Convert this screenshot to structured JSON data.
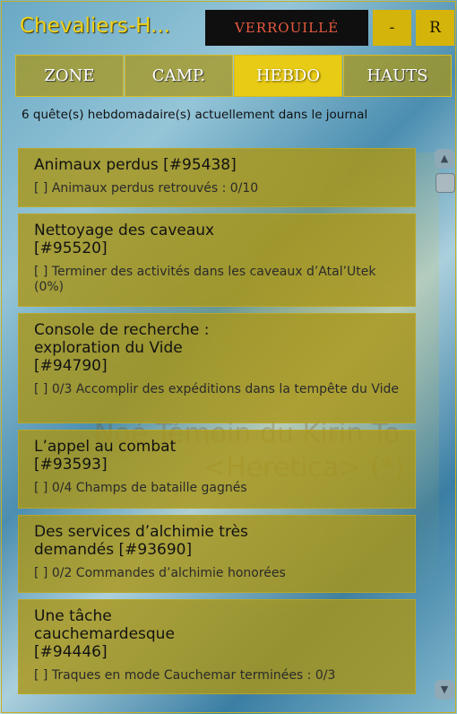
{
  "header": {
    "title": "Chevaliers-H...",
    "lock_label": "VERROUILLÉ",
    "minimize_label": "-",
    "reset_label": "R"
  },
  "tabs": [
    {
      "label": "ZONE"
    },
    {
      "label": "CAMP."
    },
    {
      "label": "HEBDO"
    },
    {
      "label": "HAUTS"
    }
  ],
  "summary": "6 quête(s) hebdomadaire(s) actuellement dans le journal",
  "quests": [
    {
      "title": "Animaux perdus",
      "id": "[#95438]",
      "objective": "[ ] Animaux perdus retrouvés : 0/10"
    },
    {
      "title": "Nettoyage des caveaux",
      "id": "[#95520]",
      "objective": "[ ] Terminer des activités dans les caveaux d’Atal’Utek (0%)"
    },
    {
      "title": "Console de recherche : exploration du Vide",
      "id": "[#94790]",
      "objective": "[ ] 0/3 Accomplir des expéditions dans la tempête du Vide"
    },
    {
      "title": "L’appel au combat",
      "id": "[#93593]",
      "objective": "[ ] 0/4 Champs de bataille gagnés"
    },
    {
      "title": "Des services d’alchimie très demandés",
      "id": "[#93690]",
      "objective": "[ ] 0/2 Commandes d’alchimie honorées"
    },
    {
      "title": "Une tâche cauchemardesque",
      "id": "[#94446]",
      "objective": "[ ] Traques en mode Cauchemar terminées : 0/3"
    }
  ],
  "background_nameplate": {
    "line1": "Noé Témoin du Kirin To",
    "line2": "<Heretica> (*)"
  },
  "icons": {
    "scroll_up": "chevron-up-icon",
    "scroll_down": "chevron-down-icon"
  }
}
